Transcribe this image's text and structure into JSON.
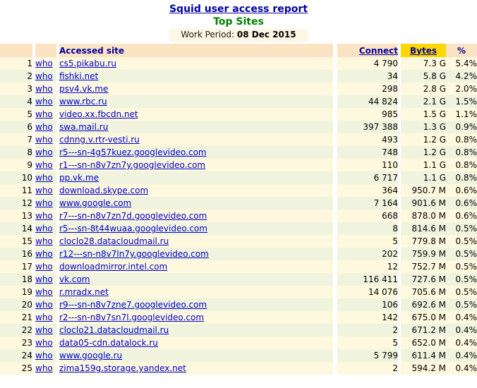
{
  "header": {
    "report_title": "Squid user access report",
    "report_subtitle": "Top Sites",
    "period_label": "Work Period:",
    "period_value": "08 Dec 2015",
    "colors": {
      "title_blue": "#0000a0",
      "subtitle_green": "#008000",
      "bytes_highlight": "#ffd700",
      "header_bg": "#fce3c3",
      "row_odd_bg": "#fdf8de",
      "row_even_bg": "#f0f4de",
      "link_blue": "#0000cc"
    }
  },
  "table": {
    "columns": {
      "rank": "",
      "who": "",
      "site": "Accessed site",
      "connect": "Connect",
      "bytes": "Bytes",
      "percent": "%"
    },
    "who_label": "who",
    "rows": [
      {
        "rank": "1",
        "who": "who",
        "site": "cs5.pikabu.ru",
        "connect": "4 790",
        "bytes": "7.3 G",
        "percent": "5.4%"
      },
      {
        "rank": "2",
        "who": "who",
        "site": "fishki.net",
        "connect": "34",
        "bytes": "5.8 G",
        "percent": "4.2%"
      },
      {
        "rank": "3",
        "who": "who",
        "site": "psv4.vk.me",
        "connect": "298",
        "bytes": "2.8 G",
        "percent": "2.0%"
      },
      {
        "rank": "4",
        "who": "who",
        "site": "www.rbc.ru",
        "connect": "44 824",
        "bytes": "2.1 G",
        "percent": "1.5%"
      },
      {
        "rank": "5",
        "who": "who",
        "site": "video.xx.fbcdn.net",
        "connect": "985",
        "bytes": "1.5 G",
        "percent": "1.1%"
      },
      {
        "rank": "6",
        "who": "who",
        "site": "swa.mail.ru",
        "connect": "397 388",
        "bytes": "1.3 G",
        "percent": "0.9%"
      },
      {
        "rank": "7",
        "who": "who",
        "site": "cdnng.v.rtr-vesti.ru",
        "connect": "493",
        "bytes": "1.2 G",
        "percent": "0.8%"
      },
      {
        "rank": "8",
        "who": "who",
        "site": "r5---sn-4g57kuez.googlevideo.com",
        "connect": "748",
        "bytes": "1.2 G",
        "percent": "0.8%"
      },
      {
        "rank": "9",
        "who": "who",
        "site": "r1---sn-n8v7zn7y.googlevideo.com",
        "connect": "110",
        "bytes": "1.1 G",
        "percent": "0.8%"
      },
      {
        "rank": "10",
        "who": "who",
        "site": "pp.vk.me",
        "connect": "6 717",
        "bytes": "1.1 G",
        "percent": "0.8%"
      },
      {
        "rank": "11",
        "who": "who",
        "site": "download.skype.com",
        "connect": "364",
        "bytes": "950.7 M",
        "percent": "0.6%"
      },
      {
        "rank": "12",
        "who": "who",
        "site": "www.google.com",
        "connect": "7 164",
        "bytes": "901.6 M",
        "percent": "0.6%"
      },
      {
        "rank": "13",
        "who": "who",
        "site": "r7---sn-n8v7zn7d.googlevideo.com",
        "connect": "668",
        "bytes": "878.0 M",
        "percent": "0.6%"
      },
      {
        "rank": "14",
        "who": "who",
        "site": "r5---sn-8t44wuaa.googlevideo.com",
        "connect": "8",
        "bytes": "814.6 M",
        "percent": "0.5%"
      },
      {
        "rank": "15",
        "who": "who",
        "site": "cloclo28.datacloudmail.ru",
        "connect": "5",
        "bytes": "779.8 M",
        "percent": "0.5%"
      },
      {
        "rank": "16",
        "who": "who",
        "site": "r12---sn-n8v7ln7y.googlevideo.com",
        "connect": "202",
        "bytes": "759.9 M",
        "percent": "0.5%"
      },
      {
        "rank": "17",
        "who": "who",
        "site": "downloadmirror.intel.com",
        "connect": "12",
        "bytes": "752.7 M",
        "percent": "0.5%"
      },
      {
        "rank": "18",
        "who": "who",
        "site": "vk.com",
        "connect": "116 411",
        "bytes": "727.6 M",
        "percent": "0.5%"
      },
      {
        "rank": "19",
        "who": "who",
        "site": "r.mradx.net",
        "connect": "14 076",
        "bytes": "705.6 M",
        "percent": "0.5%"
      },
      {
        "rank": "20",
        "who": "who",
        "site": "r9---sn-n8v7zne7.googlevideo.com",
        "connect": "106",
        "bytes": "692.6 M",
        "percent": "0.5%"
      },
      {
        "rank": "21",
        "who": "who",
        "site": "r2---sn-n8v7sn7l.googlevideo.com",
        "connect": "142",
        "bytes": "675.0 M",
        "percent": "0.4%"
      },
      {
        "rank": "22",
        "who": "who",
        "site": "cloclo21.datacloudmail.ru",
        "connect": "2",
        "bytes": "671.2 M",
        "percent": "0.4%"
      },
      {
        "rank": "23",
        "who": "who",
        "site": "data05-cdn.datalock.ru",
        "connect": "5",
        "bytes": "652.0 M",
        "percent": "0.4%"
      },
      {
        "rank": "24",
        "who": "who",
        "site": "www.google.ru",
        "connect": "5 799",
        "bytes": "611.4 M",
        "percent": "0.4%"
      },
      {
        "rank": "25",
        "who": "who",
        "site": "zima159g.storage.yandex.net",
        "connect": "2",
        "bytes": "594.2 M",
        "percent": "0.4%"
      }
    ]
  }
}
